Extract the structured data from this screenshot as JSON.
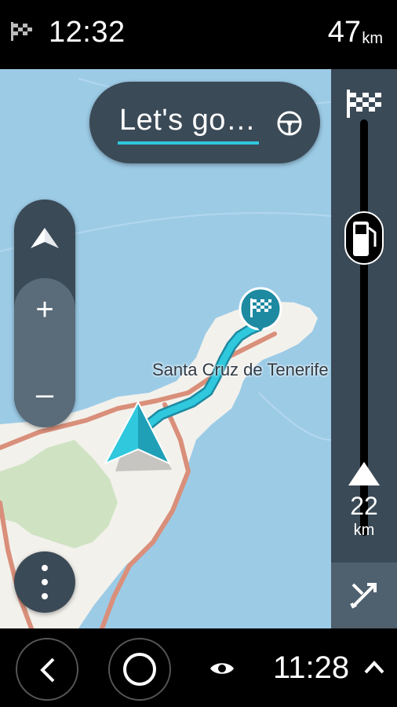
{
  "status_bar": {
    "arrival_time": "12:32",
    "remaining_distance": "47",
    "distance_unit": "km"
  },
  "map": {
    "city_label": "Santa Cruz de Tenerife",
    "sea_color": "#9ccbe6",
    "land_color": "#f3f1ec",
    "park_color": "#cfe3c2",
    "route_color": "#2fc8dd"
  },
  "lets_go": {
    "label": "Let's go…",
    "icon": "steering-wheel-icon"
  },
  "zoom_control": {
    "compass_icon": "north-arrow-icon",
    "zoom_in": "+",
    "zoom_out": "–"
  },
  "route_bar": {
    "destination_icon": "checkered-flag-icon",
    "poi_icon": "fuel-station-icon",
    "current_icon": "chevron-up-icon",
    "next_distance": "22",
    "next_unit": "km",
    "route_icon": "cancel-route-icon"
  },
  "menu_button": {
    "icon": "more-vertical-icon"
  },
  "system_nav": {
    "back_icon": "back-chevron-icon",
    "home_icon": "home-circle-icon",
    "eye_icon": "eye-icon",
    "clock": "11:28",
    "expand_icon": "chevron-up-icon"
  }
}
